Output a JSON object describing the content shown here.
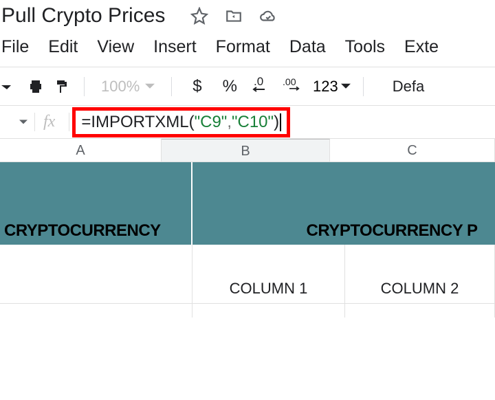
{
  "doc": {
    "title": "Pull Crypto Prices"
  },
  "menu": {
    "file": "File",
    "edit": "Edit",
    "view": "View",
    "insert": "Insert",
    "format": "Format",
    "data": "Data",
    "tools": "Tools",
    "extensions": "Exte"
  },
  "toolbar": {
    "zoom": "100%",
    "currency": "$",
    "percent": "%",
    "num_format": "123",
    "default_font": "Defa"
  },
  "formula": {
    "fx": "fx",
    "eq": "=",
    "fn": "IMPORTXML",
    "open": "(",
    "arg1": "\"C9\"",
    "comma": ",",
    "arg2": "\"C10\"",
    "close": ")"
  },
  "columns": {
    "a": "A",
    "b": "B",
    "c": "C"
  },
  "headers": {
    "col_a": "CRYPTOCURRENCY",
    "col_bc": "CRYPTOCURRENCY P"
  },
  "subheaders": {
    "b": "COLUMN 1",
    "c": "COLUMN 2"
  },
  "colors": {
    "teal": "#4d8891",
    "highlight": "#ff0000"
  }
}
